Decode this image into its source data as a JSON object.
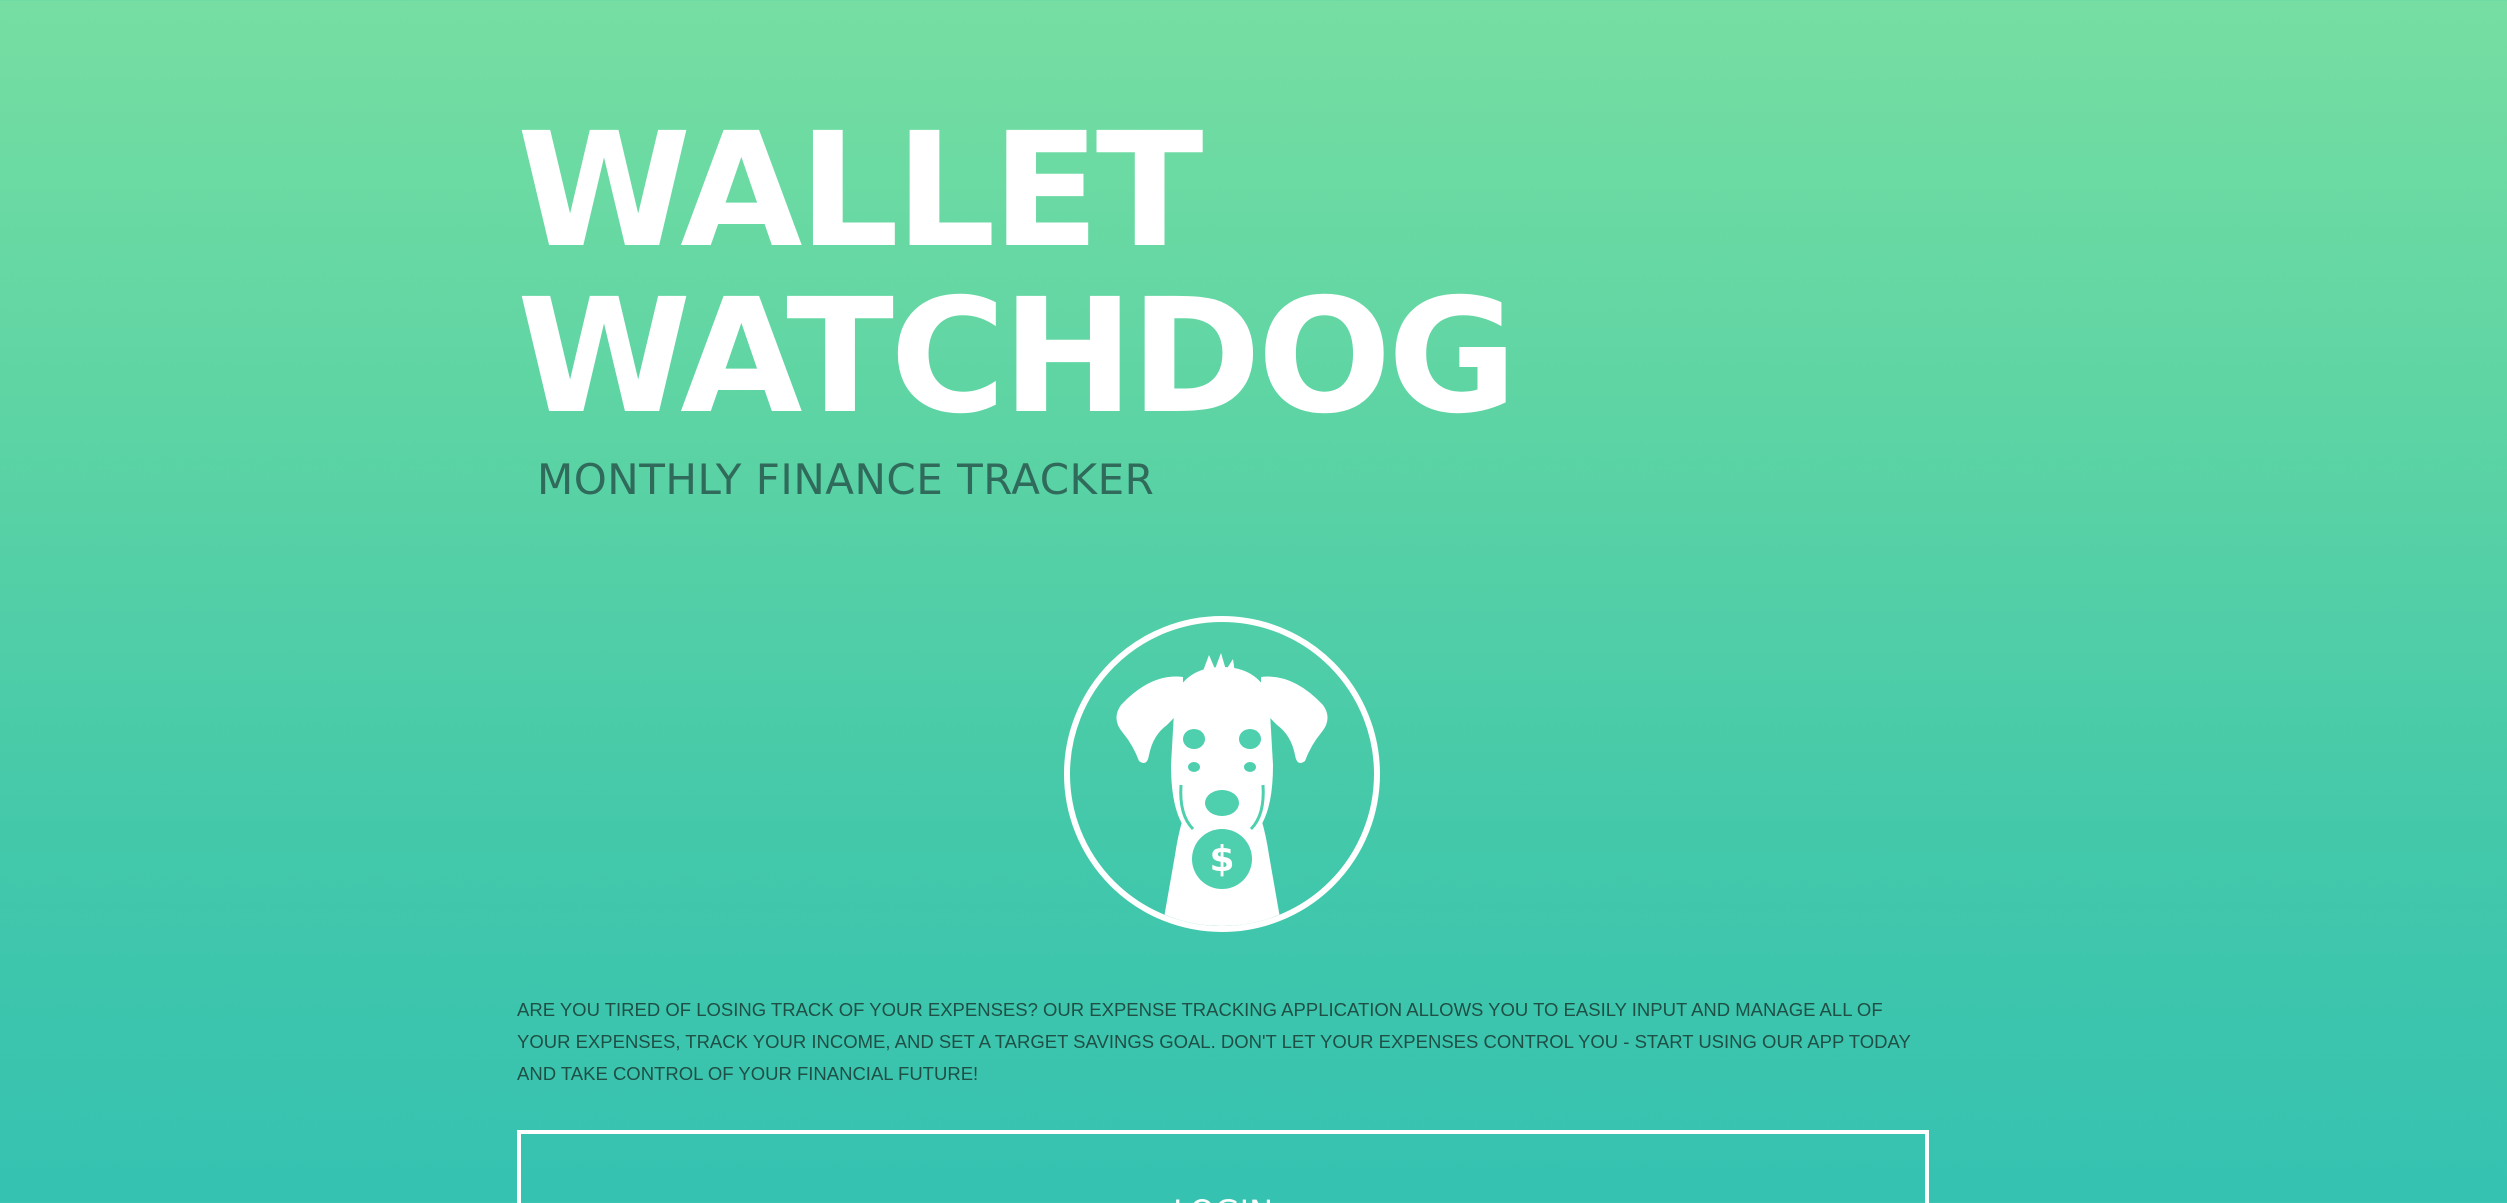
{
  "header": {
    "title_line_1": "WALLET",
    "title_line_2": "WATCHDOG",
    "subtitle": "MONTHLY FINANCE TRACKER"
  },
  "logo": {
    "icon": "dog-with-dollar-tag-icon"
  },
  "main": {
    "description": "ARE YOU TIRED OF LOSING TRACK OF YOUR EXPENSES? OUR EXPENSE TRACKING APPLICATION ALLOWS YOU TO EASILY INPUT AND MANAGE ALL OF YOUR EXPENSES, TRACK YOUR INCOME, AND SET A TARGET SAVINGS GOAL. DON'T LET YOUR EXPENSES CONTROL YOU - START USING OUR APP TODAY AND TAKE CONTROL OF YOUR FINANCIAL FUTURE!",
    "login_label": "LOGIN"
  },
  "colors": {
    "gradient_top": "#76dea2",
    "gradient_bottom": "#35c2b1",
    "title": "#ffffff",
    "subtitle": "#2f6a5a",
    "body_text": "#1f4f45",
    "accent": "#4ecfad"
  }
}
